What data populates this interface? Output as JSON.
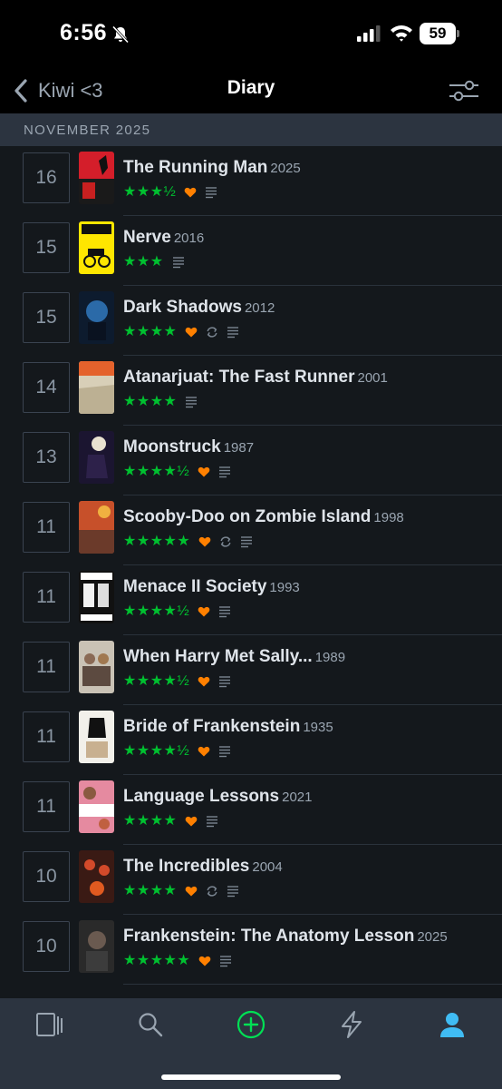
{
  "status_bar": {
    "time": "6:56",
    "battery": "59",
    "icons": [
      "bell-slash-icon",
      "cellular-signal-icon",
      "wifi-icon",
      "battery-icon"
    ]
  },
  "nav": {
    "back_label": "Kiwi <3",
    "title": "Diary",
    "back_icon": "chevron-left-icon",
    "filter_icon": "sliders-icon"
  },
  "month": "NOVEMBER 2025",
  "colors": {
    "stars": "#00c030",
    "heart": "#ff8000",
    "muted": "#9aa5b1",
    "background": "#14181c",
    "header": "#2c3440",
    "tab_active": "#40bcf4",
    "add": "#00e054"
  },
  "entries": [
    {
      "day": "16",
      "title": "The Running Man",
      "year": "2025",
      "stars": "★★★½",
      "liked": true,
      "rewatch": false,
      "review": true
    },
    {
      "day": "15",
      "title": "Nerve",
      "year": "2016",
      "stars": "★★★",
      "liked": false,
      "rewatch": false,
      "review": true
    },
    {
      "day": "15",
      "title": "Dark Shadows",
      "year": "2012",
      "stars": "★★★★",
      "liked": true,
      "rewatch": true,
      "review": true
    },
    {
      "day": "14",
      "title": "Atanarjuat: The Fast Runner",
      "year": "2001",
      "stars": "★★★★",
      "liked": false,
      "rewatch": false,
      "review": true
    },
    {
      "day": "13",
      "title": "Moonstruck",
      "year": "1987",
      "stars": "★★★★½",
      "liked": true,
      "rewatch": false,
      "review": true
    },
    {
      "day": "11",
      "title": "Scooby-Doo on Zombie Island",
      "year": "1998",
      "stars": "★★★★★",
      "liked": true,
      "rewatch": true,
      "review": true
    },
    {
      "day": "11",
      "title": "Menace II Society",
      "year": "1993",
      "stars": "★★★★½",
      "liked": true,
      "rewatch": false,
      "review": true
    },
    {
      "day": "11",
      "title": "When Harry Met Sally...",
      "year": "1989",
      "stars": "★★★★½",
      "liked": true,
      "rewatch": false,
      "review": true
    },
    {
      "day": "11",
      "title": "Bride of Frankenstein",
      "year": "1935",
      "stars": "★★★★½",
      "liked": true,
      "rewatch": false,
      "review": true
    },
    {
      "day": "11",
      "title": "Language Lessons",
      "year": "2021",
      "stars": "★★★★",
      "liked": true,
      "rewatch": false,
      "review": true
    },
    {
      "day": "10",
      "title": "The Incredibles",
      "year": "2004",
      "stars": "★★★★",
      "liked": true,
      "rewatch": true,
      "review": true
    },
    {
      "day": "10",
      "title": "Frankenstein: The Anatomy Lesson",
      "year": "2025",
      "stars": "★★★★★",
      "liked": true,
      "rewatch": false,
      "review": true
    }
  ],
  "tabs": [
    {
      "name": "films-tab",
      "icon": "film-icon"
    },
    {
      "name": "search-tab",
      "icon": "search-icon"
    },
    {
      "name": "add-tab",
      "icon": "plus-circle-icon"
    },
    {
      "name": "activity-tab",
      "icon": "lightning-icon"
    },
    {
      "name": "profile-tab",
      "icon": "person-icon",
      "active": true
    }
  ]
}
